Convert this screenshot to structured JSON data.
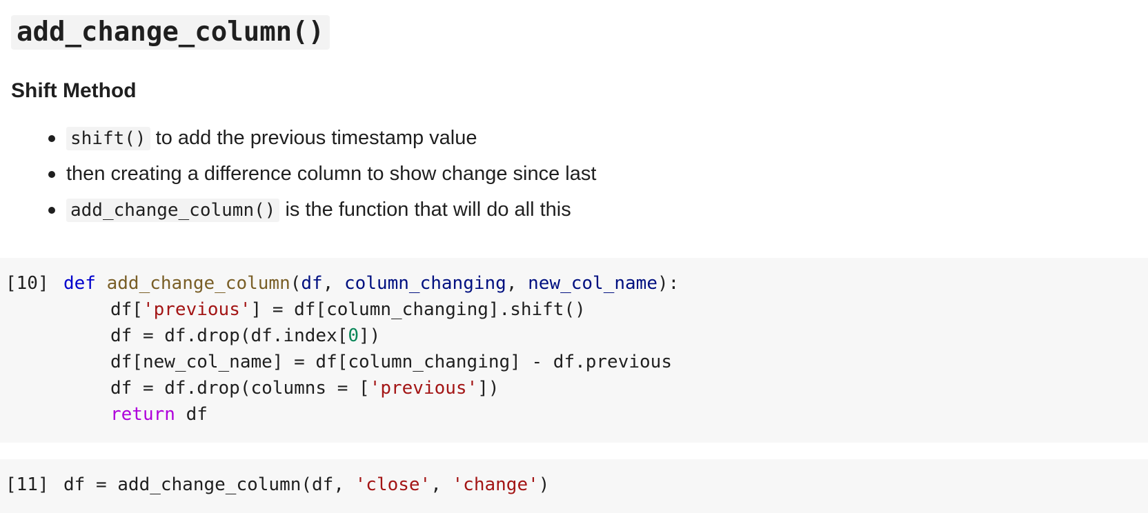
{
  "markdown": {
    "title": "add_change_column()",
    "subtitle": "Shift Method",
    "bullets": [
      {
        "code": "shift()",
        "text": " to add the previous timestamp value"
      },
      {
        "text": "then creating a difference column to show change since last"
      },
      {
        "code": "add_change_column()",
        "text": " is the function that will do all this"
      }
    ]
  },
  "cells": [
    {
      "count": "[10]",
      "lines": [
        {
          "t1": "def",
          "t2": " ",
          "t3": "add_change_column",
          "t4": "(",
          "t5": "df",
          "t6": ", ",
          "t7": "column_changing",
          "t8": ", ",
          "t9": "new_col_name",
          "t10": "):"
        },
        {
          "a": "df[",
          "b": "'previous'",
          "c": "] = df[column_changing].shift()"
        },
        {
          "a": "df = df.drop(df.index[",
          "b": "0",
          "c": "])"
        },
        {
          "a": "df[new_col_name] = df[column_changing] - df.previous"
        },
        {
          "a": "df = df.drop(columns = [",
          "b": "'previous'",
          "c": "])"
        },
        {
          "a": "return",
          "b": " df"
        }
      ]
    },
    {
      "count": "[11]",
      "lines": [
        {
          "a": "df = add_change_column(df, ",
          "b": "'close'",
          "c": ", ",
          "d": "'change'",
          "e": ")"
        }
      ]
    }
  ],
  "colors": {
    "keyword": "#0000cc",
    "function": "#795e26",
    "parameter": "#001080",
    "string": "#a31515",
    "number": "#098658",
    "return_keyword": "#af00db",
    "cell_background": "#f7f7f7"
  }
}
